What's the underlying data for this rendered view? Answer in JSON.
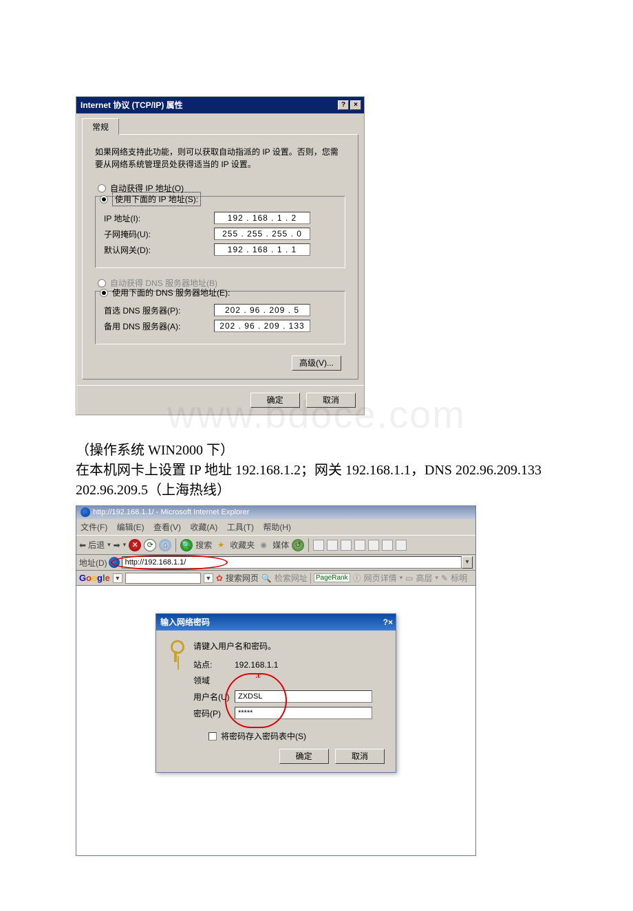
{
  "tcpip_dialog": {
    "title": "Internet 协议 (TCP/IP) 属性",
    "help_btn": "?",
    "close_btn": "×",
    "tab_general": "常规",
    "description": "如果网络支持此功能，则可以获取自动指派的 IP 设置。否则，您需要从网络系统管理员处获得适当的 IP 设置。",
    "radio_auto_ip": "自动获得 IP 地址(O)",
    "radio_use_ip": "使用下面的 IP 地址(S):",
    "label_ip": "IP 地址(I):",
    "value_ip": "192 . 168 .  1  .  2",
    "label_mask": "子网掩码(U):",
    "value_mask": "255 . 255 . 255 .  0",
    "label_gw": "默认网关(D):",
    "value_gw": "192 . 168 .  1  .  1",
    "radio_auto_dns": "自动获得 DNS 服务器地址(B)",
    "radio_use_dns": "使用下面的 DNS 服务器地址(E):",
    "label_dns1": "首选 DNS 服务器(P):",
    "value_dns1": "202 . 96  . 209 .  5",
    "label_dns2": "备用 DNS 服务器(A):",
    "value_dns2": "202 . 96  . 209 . 133",
    "advanced_btn": "高级(V)...",
    "ok_btn": "确定",
    "cancel_btn": "取消"
  },
  "doc_text": {
    "line1": "（操作系统 WIN2000 下）",
    "line2": "在本机网卡上设置 IP 地址 192.168.1.2；网关 192.168.1.1，DNS 202.96.209.133 202.96.209.5（上海热线）"
  },
  "watermark": "www.bdoce.com",
  "ie_window": {
    "title": "http://192.168.1.1/ - Microsoft Internet Explorer",
    "menu": {
      "file": "文件(F)",
      "edit": "编辑(E)",
      "view": "查看(V)",
      "favorites": "收藏(A)",
      "tools": "工具(T)",
      "help": "帮助(H)"
    },
    "toolbar": {
      "back": "后退",
      "search": "搜索",
      "favorites": "收藏夹",
      "media": "媒体"
    },
    "address_label": "地址(D)",
    "address_value": "http://192.168.1.1/",
    "google": {
      "dropdown_arrow": "▼",
      "search_web": "搜索网页",
      "search_site": "检索网址",
      "pagerank": "PageRank",
      "page_info": "网页详情",
      "up": "高层",
      "highlight": "标明"
    }
  },
  "auth_dialog": {
    "title": "输入网络密码",
    "help_btn": "?",
    "close_btn": "×",
    "prompt": "请键入用户名和密码。",
    "site_label": "站点:",
    "site_value": "192.168.1.1",
    "realm_label": "领域",
    "user_label": "用户名(U)",
    "user_value": "ZXDSL",
    "pass_label": "密码(P)",
    "pass_value": "*****",
    "save_cb": "将密码存入密码表中(S)",
    "ok_btn": "确定",
    "cancel_btn": "取消"
  }
}
